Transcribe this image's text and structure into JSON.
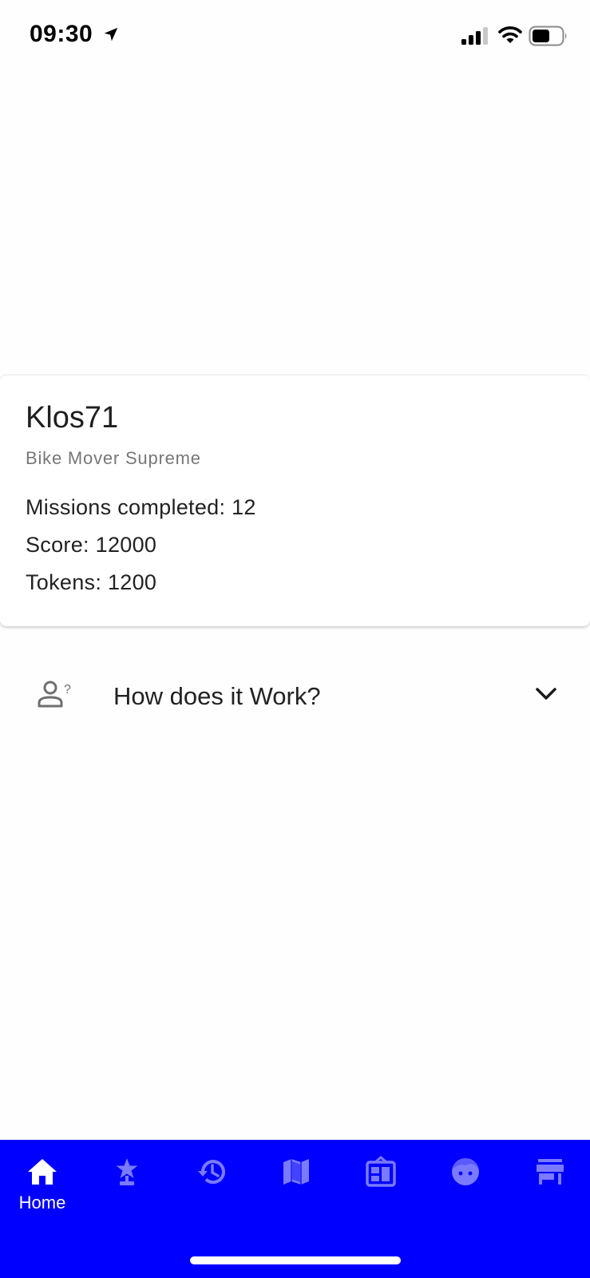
{
  "status_bar": {
    "time": "09:30",
    "icons": [
      "location-arrow-icon",
      "cellular-signal-icon",
      "wifi-icon",
      "battery-icon"
    ]
  },
  "profile": {
    "username": "Klos71",
    "rank": "Bike Mover Supreme",
    "missions_completed": "Missions completed: 12",
    "score": "Score: 12000",
    "tokens": "Tokens: 1200"
  },
  "how_it_works": {
    "label": "How does it Work?",
    "icon": "person-question-icon",
    "expand_icon": "chevron-down-icon"
  },
  "bottom_nav": {
    "background": "#0000ff",
    "active_color": "#ffffff",
    "inactive_color": "#7a7aff",
    "items": [
      {
        "label": "Home",
        "icon": "home-icon",
        "active": true
      },
      {
        "icon": "trophy-star-icon",
        "active": false
      },
      {
        "icon": "history-icon",
        "active": false
      },
      {
        "icon": "map-icon",
        "active": false
      },
      {
        "icon": "news-icon",
        "active": false
      },
      {
        "icon": "face-icon",
        "active": false
      },
      {
        "icon": "store-icon",
        "active": false
      }
    ]
  }
}
